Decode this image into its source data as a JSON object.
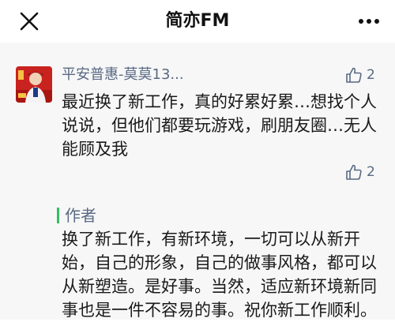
{
  "header": {
    "title": "简亦FM",
    "close_icon": "close-icon",
    "more_icon": "more-icon"
  },
  "comment": {
    "nickname": "平安普惠-莫莫13...",
    "like_count": "2",
    "text": "最近换了新工作，真的好累好累…想找个人说说，但他们都要玩游戏，刷朋友圈…无人能顾及我"
  },
  "reply": {
    "author_label": "作者",
    "like_count": "2",
    "text": "换了新工作，有新环境，一切可以从新开始，自己的形象，自己的做事风格，都可以从新塑造。是好事。当然，适应新环境新同事也是一件不容易的事。祝你新工作顺利。"
  },
  "colors": {
    "link_blue": "#596983",
    "author_green": "#2fbf62",
    "background": "#f7f7f7"
  }
}
